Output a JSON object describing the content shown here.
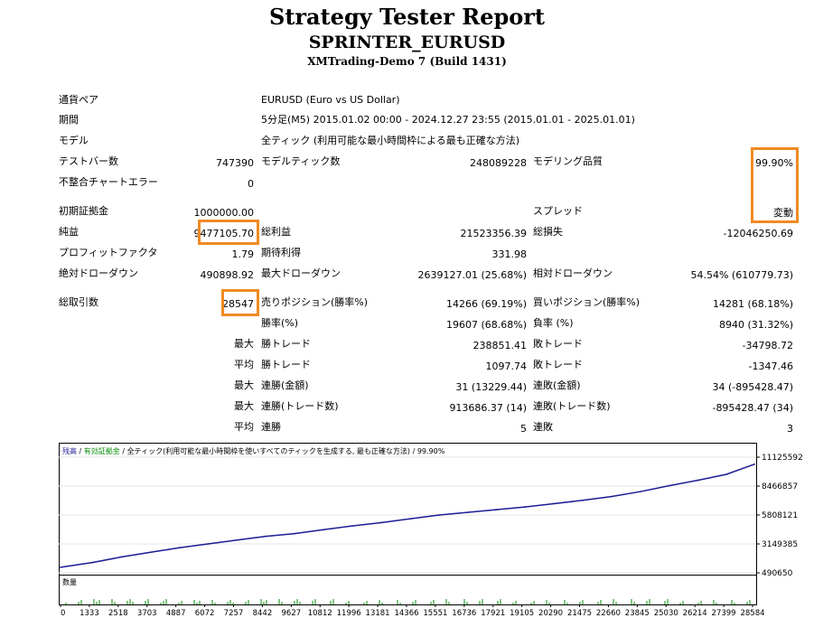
{
  "header": {
    "title": "Strategy Tester Report",
    "expert": "SPRINTER_EURUSD",
    "server": "XMTrading-Demo 7 (Build 1431)"
  },
  "info": {
    "symbol_label": "通貨ペア",
    "symbol_value": "EURUSD (Euro vs US Dollar)",
    "period_label": "期間",
    "period_value": "5分足(M5) 2015.01.02 00:00 - 2024.12.27 23:55 (2015.01.01 - 2025.01.01)",
    "model_label": "モデル",
    "model_value": "全ティック (利用可能な最小時間枠による最も正確な方法)",
    "bars_label": "テストバー数",
    "bars_value": "747390",
    "ticks_label": "モデルティック数",
    "ticks_value": "248089228",
    "quality_label": "モデリング品質",
    "quality_value": "99.90%",
    "errors_label": "不整合チャートエラー",
    "errors_value": "0"
  },
  "stats": {
    "deposit_label": "初期証拠金",
    "deposit_value": "1000000.00",
    "spread_label": "スプレッド",
    "spread_value": "変動",
    "net_label": "純益",
    "net_value": "9477105.70",
    "gross_profit_label": "総利益",
    "gross_profit_value": "21523356.39",
    "gross_loss_label": "総損失",
    "gross_loss_value": "-12046250.69",
    "pf_label": "プロフィットファクタ",
    "pf_value": "1.79",
    "expected_label": "期待利得",
    "expected_value": "331.98",
    "abs_dd_label": "絶対ドローダウン",
    "abs_dd_value": "490898.92",
    "max_dd_label": "最大ドローダウン",
    "max_dd_value": "2639127.01 (25.68%)",
    "rel_dd_label": "相対ドローダウン",
    "rel_dd_value": "54.54% (610779.73)",
    "total_label": "総取引数",
    "total_value": "28547",
    "short_label": "売りポジション(勝率%)",
    "short_value": "14266 (69.19%)",
    "long_label": "買いポジション(勝率%)",
    "long_value": "14281 (68.18%)",
    "win_rate_label": "勝率(%)",
    "win_rate_value": "19607 (68.68%)",
    "loss_rate_label": "負率 (%)",
    "loss_rate_value": "8940 (31.32%)",
    "max_label": "最大",
    "max_win_label": "勝トレード",
    "max_win_value": "238851.41",
    "max_loss_label": "敗トレード",
    "max_loss_value": "-34798.72",
    "avg_label": "平均",
    "avg_win_label": "勝トレード",
    "avg_win_value": "1097.74",
    "avg_loss_label": "敗トレード",
    "avg_loss_value": "-1347.46",
    "max2_label": "最大",
    "cons_wins_amt_label": "連勝(金額)",
    "cons_wins_amt_value": "31 (13229.44)",
    "cons_loss_amt_label": "連敗(金額)",
    "cons_loss_amt_value": "34 (-895428.47)",
    "max3_label": "最大",
    "cons_profit_label": "連勝(トレード数)",
    "cons_profit_value": "913686.37 (14)",
    "cons_lossn_label": "連敗(トレード数)",
    "cons_lossn_value": "-895428.47 (34)",
    "avg2_label": "平均",
    "avg_cons_win_label": "連勝",
    "avg_cons_win_value": "5",
    "avg_cons_loss_label": "連敗",
    "avg_cons_loss_value": "3"
  },
  "chart_header": {
    "balance": "残高",
    "sep1": " / ",
    "equity": "有効証拠金",
    "rest": " / 全ティック(利用可能な最小時間枠を使いすべてのティックを生成する, 最も正確な方法) / 99.90%"
  },
  "volume_label": "数量",
  "colors": {
    "balance": "#1c1c94",
    "equity": "#0a8f0a",
    "highlight": "#f08a24"
  },
  "chart_data": [
    {
      "type": "line",
      "title": "",
      "xlabel": "",
      "ylabel": "",
      "ylim": [
        490650,
        11125592
      ],
      "y_ticks": [
        "11125592",
        "8466857",
        "5808121",
        "3149385",
        "490650"
      ],
      "x": [
        0,
        1333,
        2518,
        3703,
        4887,
        6072,
        7257,
        8442,
        9627,
        10812,
        11996,
        13181,
        14366,
        15551,
        16736,
        17921,
        19105,
        20290,
        21475,
        22660,
        23845,
        25030,
        26214,
        27399,
        28547
      ],
      "series": [
        {
          "values": [
            1000000,
            1450000,
            1950000,
            2380000,
            2800000,
            3150000,
            3500000,
            3850000,
            4100000,
            4450000,
            4800000,
            5100000,
            5450000,
            5800000,
            6050000,
            6300000,
            6550000,
            6850000,
            7150000,
            7500000,
            7950000,
            8500000,
            9000000,
            9550000,
            10477105
          ]
        }
      ]
    },
    {
      "type": "bar",
      "title": "",
      "x_ticks": [
        "0",
        "1333",
        "2518",
        "3703",
        "4887",
        "6072",
        "7257",
        "8442",
        "9627",
        "10812",
        "11996",
        "13181",
        "14366",
        "15551",
        "16736",
        "17921",
        "19105",
        "20290",
        "21475",
        "22660",
        "23845",
        "25030",
        "26214",
        "27399",
        "28584"
      ]
    }
  ]
}
